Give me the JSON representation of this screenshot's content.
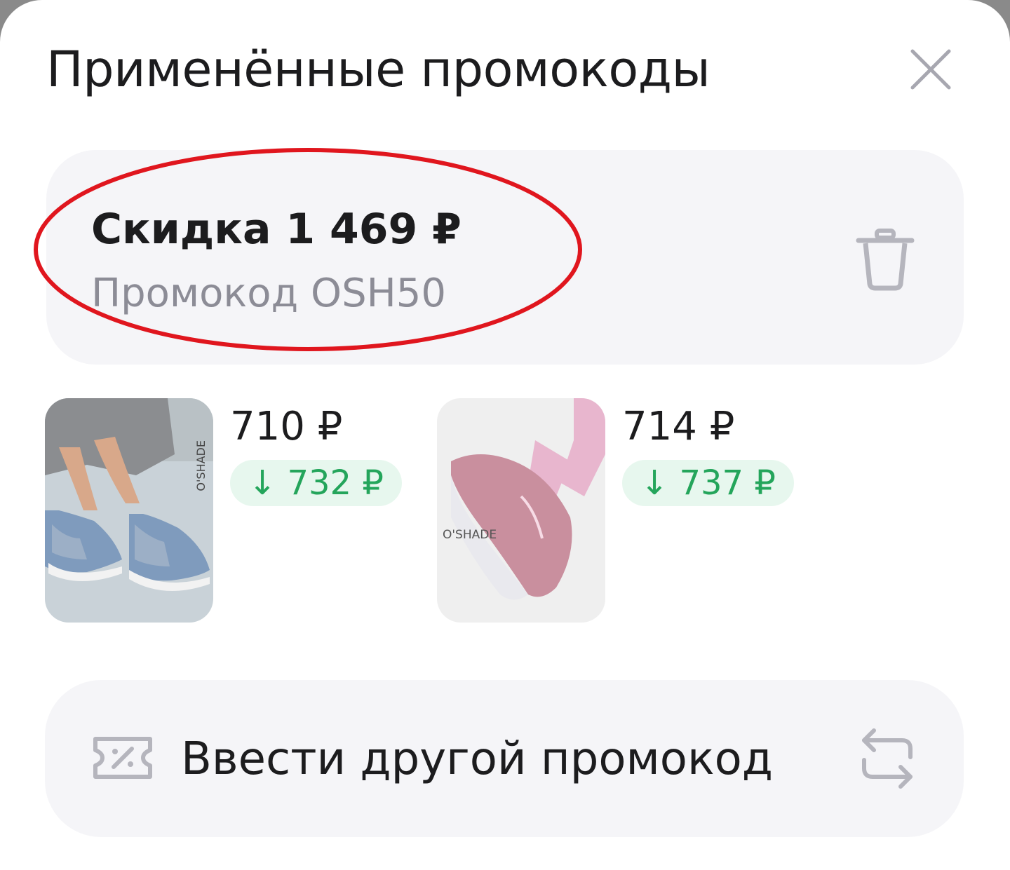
{
  "sheet": {
    "title": "Применённые промокоды"
  },
  "applied_promo": {
    "discount_label": "Скидка 1 469 ₽",
    "promo_code_label": "Промокод OSH50"
  },
  "products": [
    {
      "price": "710 ₽",
      "old_price_badge": "↓ 732 ₽",
      "brand": "O'SHADE",
      "image": "blue-sneakers-photo"
    },
    {
      "price": "714 ₽",
      "old_price_badge": "↓ 737 ₽",
      "brand": "O'SHADE",
      "image": "pink-sneakers-photo"
    }
  ],
  "enter_other": {
    "label": "Ввести другой промокод"
  },
  "icons": {
    "close": "close-icon",
    "trash": "trash-icon",
    "ticket": "promo-ticket-icon",
    "swap": "swap-arrows-icon"
  },
  "colors": {
    "text_primary": "#1c1c1e",
    "text_secondary": "#8c8c96",
    "card_bg": "#f5f5f8",
    "badge_bg": "#e7f7ee",
    "badge_text": "#24a55b",
    "annotation_red": "#e0161e"
  }
}
